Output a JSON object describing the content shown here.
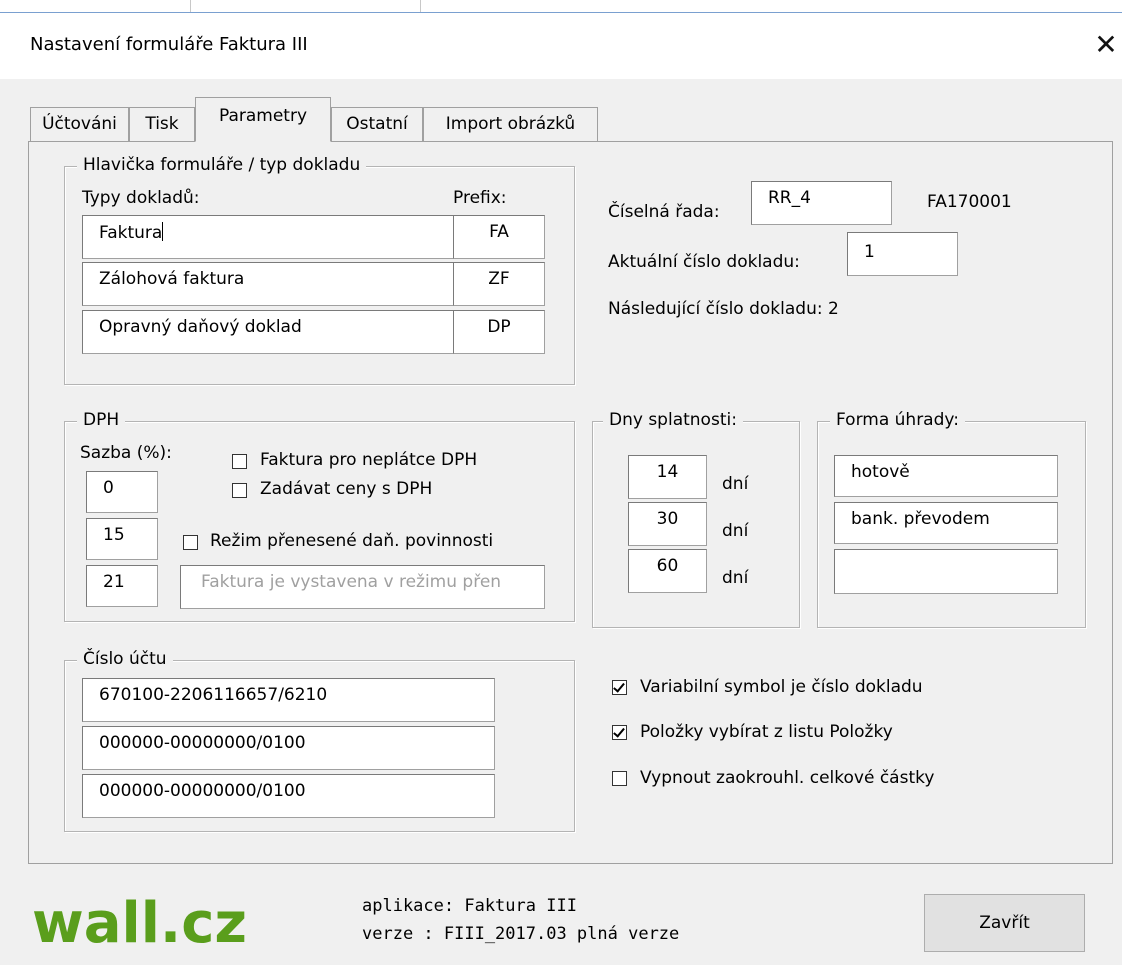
{
  "window": {
    "title": "Nastavení formuláře Faktura III",
    "close_glyph": "✕"
  },
  "tabs": [
    {
      "label": "Účtováni",
      "active": false
    },
    {
      "label": "Tisk",
      "active": false
    },
    {
      "label": "Parametry",
      "active": true
    },
    {
      "label": "Ostatní",
      "active": false
    },
    {
      "label": "Import obrázků",
      "active": false
    }
  ],
  "header_group": {
    "legend": "Hlavička formuláře / typ dokladu",
    "types_label": "Typy dokladů:",
    "prefix_label": "Prefix:",
    "rows": [
      {
        "type": "Faktura",
        "prefix": "FA"
      },
      {
        "type": "Zálohová faktura",
        "prefix": "ZF"
      },
      {
        "type": "Opravný daňový doklad",
        "prefix": "DP"
      }
    ]
  },
  "numbering": {
    "series_label": "Číselná řada:",
    "series_value": "RR_4",
    "series_code": "FA170001",
    "current_label": "Aktuální číslo dokladu:",
    "current_value": "1",
    "next_text": "Následující číslo dokladu: 2"
  },
  "vat": {
    "legend": "DPH",
    "rate_label": "Sazba (%):",
    "rates": [
      "0",
      "15",
      "21"
    ],
    "non_payer_label": "Faktura pro neplátce DPH",
    "non_payer_checked": false,
    "prices_with_vat_label": "Zadávat ceny s DPH",
    "prices_with_vat_checked": false,
    "reverse_charge_label": "Režim přenesené daň. povinnosti",
    "reverse_charge_checked": false,
    "reverse_charge_text": "Faktura je vystavena v režimu přen"
  },
  "due_days": {
    "legend": "Dny splatnosti:",
    "values": [
      "14",
      "30",
      "60"
    ],
    "unit": "dní"
  },
  "payment": {
    "legend": "Forma úhrady:",
    "methods": [
      "hotově",
      "bank. převodem",
      ""
    ]
  },
  "account": {
    "legend": "Číslo účtu",
    "numbers": [
      "670100-2206116657/6210",
      "000000-00000000/0100",
      "000000-00000000/0100"
    ]
  },
  "options": [
    {
      "label": "Variabilní symbol je číslo dokladu",
      "checked": true
    },
    {
      "label": "Položky vybírat z listu Položky",
      "checked": true
    },
    {
      "label": "Vypnout zaokrouhl. celkové částky",
      "checked": false
    }
  ],
  "footer": {
    "logo_text": "wall.cz",
    "app_line": "aplikace: Faktura III",
    "version_line": "verze   : FIII_2017.03 plná verze",
    "close_button": "Zavřít"
  },
  "colors": {
    "logo_green": "#5a9e1c",
    "window_bg": "#f0f0f0",
    "border": "#a0a0a0"
  }
}
